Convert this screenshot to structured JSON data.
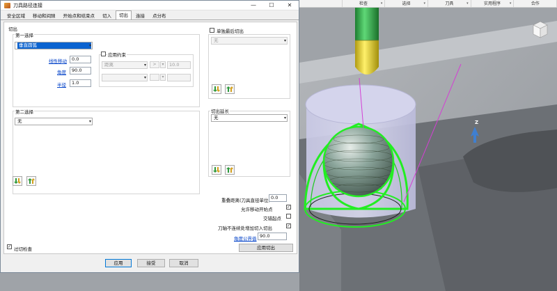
{
  "window": {
    "title": "刀具路径连接",
    "minimize": "—",
    "maximize": "☐",
    "close": "✕"
  },
  "tabs": [
    "安全区域",
    "移动和间隙",
    "开始点和结束点",
    "切入",
    "切出",
    "连接",
    "点分布"
  ],
  "active_tab": "切出",
  "exit": {
    "section_label": "切出",
    "first_choice": {
      "label": "第一选择",
      "selected": "垂直圆弧",
      "linear_move_label": "线性移动",
      "linear_move_value": "0.0",
      "angle_label": "角度",
      "angle_value": "90.0",
      "radius_label": "半径",
      "radius_value": "1.0",
      "apply_constraint_label": "应用约束",
      "constraint_type": "距离",
      "constraint_op": ">",
      "constraint_value": "10.0"
    },
    "second_choice": {
      "label": "第二选择",
      "selected": "无"
    },
    "separate_last_exit": {
      "label": "单独最后切出",
      "selected": "无"
    },
    "exit_extension": {
      "label": "切出延长",
      "selected": "无"
    },
    "overlap_distance": {
      "label": "重叠距离(刀具直径单位)",
      "value": "0.0"
    },
    "allow_move_start_point_label": "允许移动开始点",
    "alternate_start_point_label": "交错起点",
    "add_entry_exit_label": "刀轴不连续处增加切入切出",
    "angle_tolerance": {
      "label": "角度公界值",
      "value": "90.0"
    },
    "apply_exit_button": "应用切出",
    "overcut_check_label": "过切检查"
  },
  "buttons": {
    "apply": "应用",
    "accept": "接受",
    "cancel": "取消"
  },
  "viewport": {
    "menu": [
      "",
      "检查",
      "选择",
      "刀具",
      "实用程序",
      "合作"
    ],
    "axis_label": "Z"
  },
  "colors": {
    "accent": "#0078d7",
    "toolpath": "#22ee22",
    "tool_green": "#2fb24a",
    "tool_yellow": "#f2df2c"
  }
}
